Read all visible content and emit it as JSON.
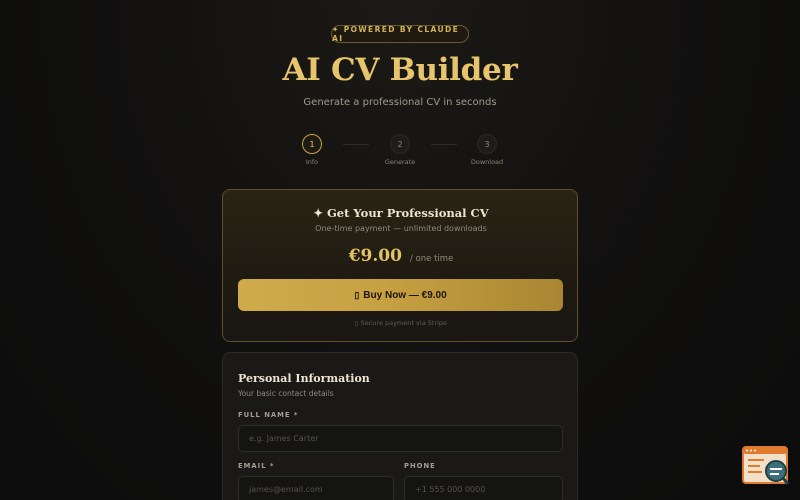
{
  "header": {
    "badge": "✦ POWERED BY CLAUDE AI",
    "title": "AI CV Builder",
    "subtitle": "Generate a professional CV in seconds"
  },
  "steps": [
    {
      "number": "1",
      "label": "Info"
    },
    {
      "number": "2",
      "label": "Generate"
    },
    {
      "number": "3",
      "label": "Download"
    }
  ],
  "payment": {
    "title": "✦ Get Your Professional CV",
    "subtitle": "One-time payment — unlimited downloads",
    "price": "€9.00",
    "price_unit": "/ one time",
    "button_label": "Buy Now — €9.00",
    "secure_note": "Secure payment via Stripe"
  },
  "personal_info": {
    "title": "Personal Information",
    "subtitle": "Your basic contact details",
    "full_name_label": "FULL NAME *",
    "full_name_placeholder": "e.g. James Carter",
    "email_label": "EMAIL *",
    "email_placeholder": "james@email.com",
    "phone_label": "PHONE",
    "phone_placeholder": "+1 555 000 0000"
  },
  "colors": {
    "accent": "#d4b25a",
    "background": "#121110",
    "card": "#1a1918"
  }
}
